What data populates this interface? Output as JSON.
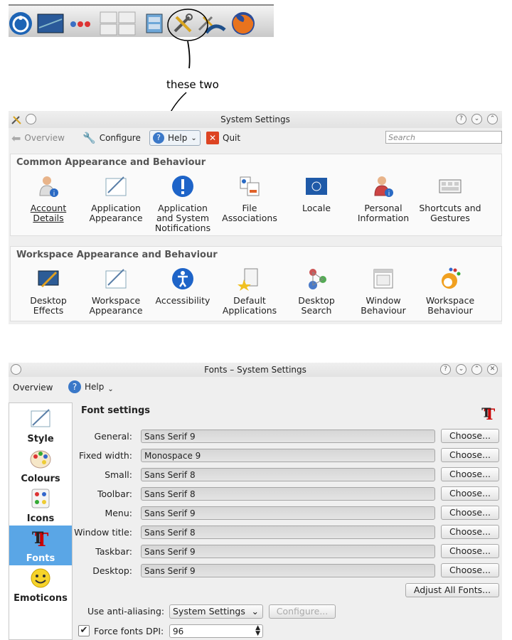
{
  "annotation": {
    "text": "these two"
  },
  "taskbar": {
    "icons": [
      "kde-menu-icon",
      "desktop-icon",
      "dots-icon",
      "pager-icon",
      "filemanager-icon",
      "system-settings-icon",
      "config-icon",
      "firefox-icon"
    ]
  },
  "system_settings": {
    "title": "System Settings",
    "toolbar": {
      "overview": "Overview",
      "configure": "Configure",
      "help": "Help",
      "quit": "Quit"
    },
    "search_placeholder": "Search",
    "group1": {
      "title": "Common Appearance and Behaviour",
      "items": [
        {
          "label": "Account Details",
          "icon": "person-info-icon"
        },
        {
          "label": "Application Appearance",
          "icon": "appearance-icon"
        },
        {
          "label": "Application and System Notifications",
          "icon": "exclamation-icon"
        },
        {
          "label": "File Associations",
          "icon": "file-assoc-icon"
        },
        {
          "label": "Locale",
          "icon": "flag-icon"
        },
        {
          "label": "Personal Information",
          "icon": "person-info-icon"
        },
        {
          "label": "Shortcuts and Gestures",
          "icon": "keyboard-icon"
        }
      ]
    },
    "group2": {
      "title": "Workspace Appearance and Behaviour",
      "items": [
        {
          "label": "Desktop Effects",
          "icon": "desktop-effects-icon"
        },
        {
          "label": "Workspace Appearance",
          "icon": "appearance-icon"
        },
        {
          "label": "Accessibility",
          "icon": "accessibility-icon"
        },
        {
          "label": "Default Applications",
          "icon": "default-apps-icon"
        },
        {
          "label": "Desktop Search",
          "icon": "desktop-search-icon"
        },
        {
          "label": "Window Behaviour",
          "icon": "window-icon"
        },
        {
          "label": "Workspace Behaviour",
          "icon": "workspace-behaviour-icon"
        }
      ]
    }
  },
  "fonts_window": {
    "title": "Fonts – System Settings",
    "toolbar": {
      "overview": "Overview",
      "help": "Help"
    },
    "sidebar": [
      {
        "label": "Style",
        "icon": "style-icon"
      },
      {
        "label": "Colours",
        "icon": "colours-icon"
      },
      {
        "label": "Icons",
        "icon": "icons-icon"
      },
      {
        "label": "Fonts",
        "icon": "fonts-icon",
        "selected": true
      },
      {
        "label": "Emoticons",
        "icon": "smiley-icon"
      }
    ],
    "heading": "Font settings",
    "rows": [
      {
        "label": "General:",
        "value": "Sans Serif 9",
        "button": "Choose..."
      },
      {
        "label": "Fixed width:",
        "value": "Monospace  9",
        "button": "Choose..."
      },
      {
        "label": "Small:",
        "value": "Sans Serif 8",
        "button": "Choose..."
      },
      {
        "label": "Toolbar:",
        "value": "Sans Serif 8",
        "button": "Choose..."
      },
      {
        "label": "Menu:",
        "value": "Sans Serif 9",
        "button": "Choose..."
      },
      {
        "label": "Window title:",
        "value": "Sans Serif 8",
        "button": "Choose..."
      },
      {
        "label": "Taskbar:",
        "value": "Sans Serif 9",
        "button": "Choose..."
      },
      {
        "label": "Desktop:",
        "value": "Sans Serif 9",
        "button": "Choose..."
      }
    ],
    "adjust_all": "Adjust All Fonts...",
    "antialias_label": "Use anti-aliasing:",
    "antialias_value": "System Settings",
    "configure": "Configure...",
    "force_dpi_label": "Force fonts DPI:",
    "force_dpi_value": "96",
    "force_dpi_checked": true
  }
}
